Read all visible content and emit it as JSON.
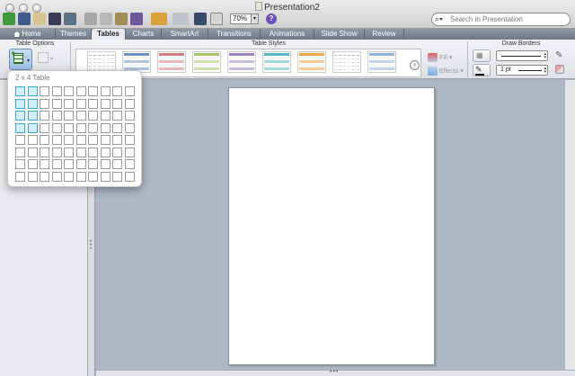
{
  "window": {
    "title": "Presentation2"
  },
  "toolbar": {
    "zoom_value": "70%",
    "zoom_arrow": "▾",
    "help_glyph": "?",
    "search_placeholder": "Search in Presentation",
    "search_glyph": "⌕▾"
  },
  "tabs": [
    {
      "label": "Home",
      "active": false
    },
    {
      "label": "Themes",
      "active": false
    },
    {
      "label": "Tables",
      "active": true
    },
    {
      "label": "Charts",
      "active": false
    },
    {
      "label": "SmartArt",
      "active": false
    },
    {
      "label": "Transitions",
      "active": false
    },
    {
      "label": "Animations",
      "active": false
    },
    {
      "label": "Slide Show",
      "active": false
    },
    {
      "label": "Review",
      "active": false
    }
  ],
  "ribbon": {
    "groups": {
      "table_options": "Table Options",
      "table_styles": "Table Styles",
      "draw_borders": "Draw Borders"
    },
    "fill_label": "Fill",
    "effects_label": "Effects",
    "line_weight": "1 pt",
    "styles_next_glyph": "›",
    "style_colors": [
      "#cfd6df",
      "#6f8fc8",
      "#d47b7b",
      "#a6c86a",
      "#9b84c4",
      "#58b8c9",
      "#f0a44a",
      "#c9c9c9",
      "#8fb2e0"
    ]
  },
  "table_popup": {
    "caption": "2 x 4 Table",
    "columns": 10,
    "rows": 8,
    "selected_columns": 2,
    "selected_rows": 4
  },
  "colors": {
    "accent_selected": "#3aa7d4",
    "ribbon_tabs": "#7e8895"
  }
}
